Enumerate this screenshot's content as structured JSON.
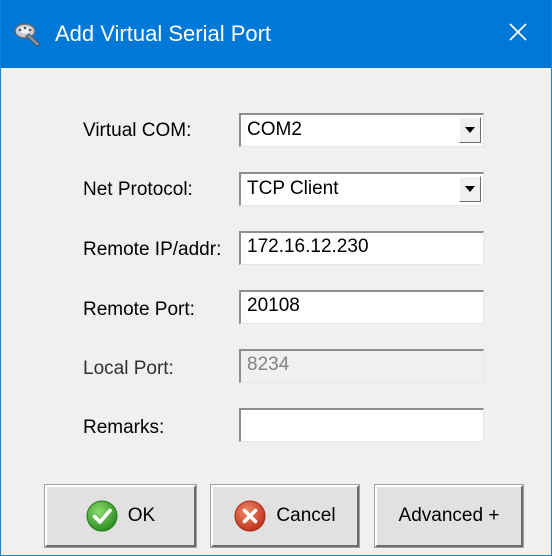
{
  "window": {
    "title": "Add Virtual Serial Port",
    "close_glyph": "✕"
  },
  "form": {
    "virtual_com": {
      "label": "Virtual COM:",
      "value": "COM2"
    },
    "net_protocol": {
      "label": "Net Protocol:",
      "value": "TCP Client"
    },
    "remote_ip": {
      "label": "Remote IP/addr:",
      "value": "172.16.12.230"
    },
    "remote_port": {
      "label": "Remote Port:",
      "value": "20108"
    },
    "local_port": {
      "label": "Local Port:",
      "value": "8234",
      "enabled": false
    },
    "remarks": {
      "label": "Remarks:",
      "value": ""
    }
  },
  "buttons": {
    "ok": {
      "label": "OK",
      "icon": "check-circle-icon"
    },
    "cancel": {
      "label": "Cancel",
      "icon": "x-circle-icon"
    },
    "advanced": {
      "label": "Advanced +"
    }
  },
  "colors": {
    "titlebar": "#0078d7",
    "ok_icon": "#3fa72f",
    "cancel_icon": "#d5442a"
  }
}
